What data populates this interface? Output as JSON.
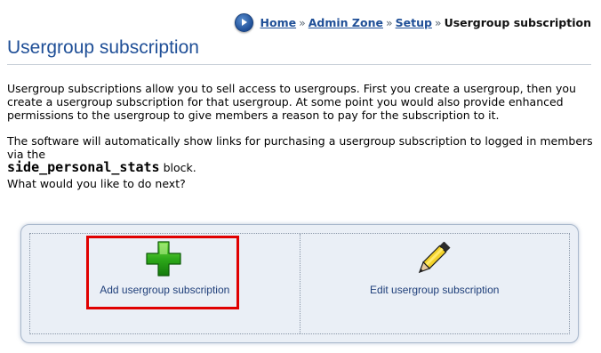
{
  "breadcrumb": {
    "home": "Home",
    "admin_zone": "Admin Zone",
    "setup": "Setup",
    "separator": "»",
    "current": "Usergroup subscription"
  },
  "page": {
    "title": "Usergroup subscription",
    "intro": "Usergroup subscriptions allow you to sell access to usergroups. First you create a usergroup, then you create a usergroup subscription for that usergroup. At some point you would also provide enhanced permissions to the usergroup to give members a reason to pay for the subscription to it.",
    "auto_links_before": "The software will automatically show links for purchasing a usergroup subscription to logged in members via the",
    "block_name": "side_personal_stats",
    "auto_links_after": "block.",
    "next_prompt": "What would you like to do next?"
  },
  "actions": [
    {
      "label": "Add usergroup subscription",
      "icon": "plus-icon"
    },
    {
      "label": "Edit usergroup subscription",
      "icon": "pencil-icon"
    }
  ],
  "colors": {
    "link": "#1f4f97",
    "highlight": "#e00000",
    "panel_bg": "#eaeff6"
  }
}
